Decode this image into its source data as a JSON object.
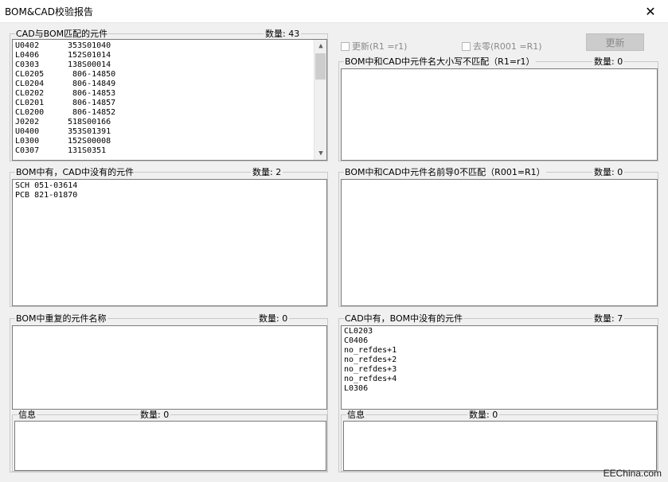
{
  "window": {
    "title": "BOM&CAD校验报告",
    "close_glyph": "✕"
  },
  "controls": {
    "update_check_label": "更新(R1 =r1)",
    "zero_check_label": "去零(R001 =R1)",
    "update_button": "更新"
  },
  "matched": {
    "title": "CAD与BOM匹配的元件",
    "count": "数量: 43",
    "rows": [
      [
        "U0402",
        "353S01040"
      ],
      [
        "L0406",
        "152S01014"
      ],
      [
        "C0303",
        "138S00014"
      ],
      [
        "CL0205",
        " 806-14850"
      ],
      [
        "CL0204",
        " 806-14849"
      ],
      [
        "CL0202",
        " 806-14853"
      ],
      [
        "CL0201",
        " 806-14857"
      ],
      [
        "CL0200",
        " 806-14852"
      ],
      [
        "J0202",
        "518S00166"
      ],
      [
        "U0400",
        "353S01391"
      ],
      [
        "L0300",
        "152S00008"
      ],
      [
        "C0307",
        "131S0351"
      ]
    ]
  },
  "case_mismatch": {
    "title": "BOM中和CAD中元件名大小写不匹配（R1=r1）",
    "count": "数量: 0"
  },
  "bom_only": {
    "title": "BOM中有，CAD中没有的元件",
    "count": "数量: 2",
    "rows": [
      "SCH 051-03614",
      "PCB 821-01870"
    ]
  },
  "leading_zero": {
    "title": "BOM中和CAD中元件名前导0不匹配（R001=R1）",
    "count": "数量: 0"
  },
  "bom_duplicate": {
    "title": "BOM中重复的元件名称",
    "count": "数量: 0",
    "info_title": "信息",
    "info_count": "数量: 0"
  },
  "cad_only": {
    "title": "CAD中有，BOM中没有的元件",
    "count": "数量: 7",
    "rows": [
      "CL0203",
      "C0406",
      "no_refdes+1",
      "no_refdes+2",
      "no_refdes+3",
      "no_refdes+4",
      "L0306"
    ],
    "info_title": "信息",
    "info_count": "数量: 0"
  },
  "watermark": "EEChina.com"
}
